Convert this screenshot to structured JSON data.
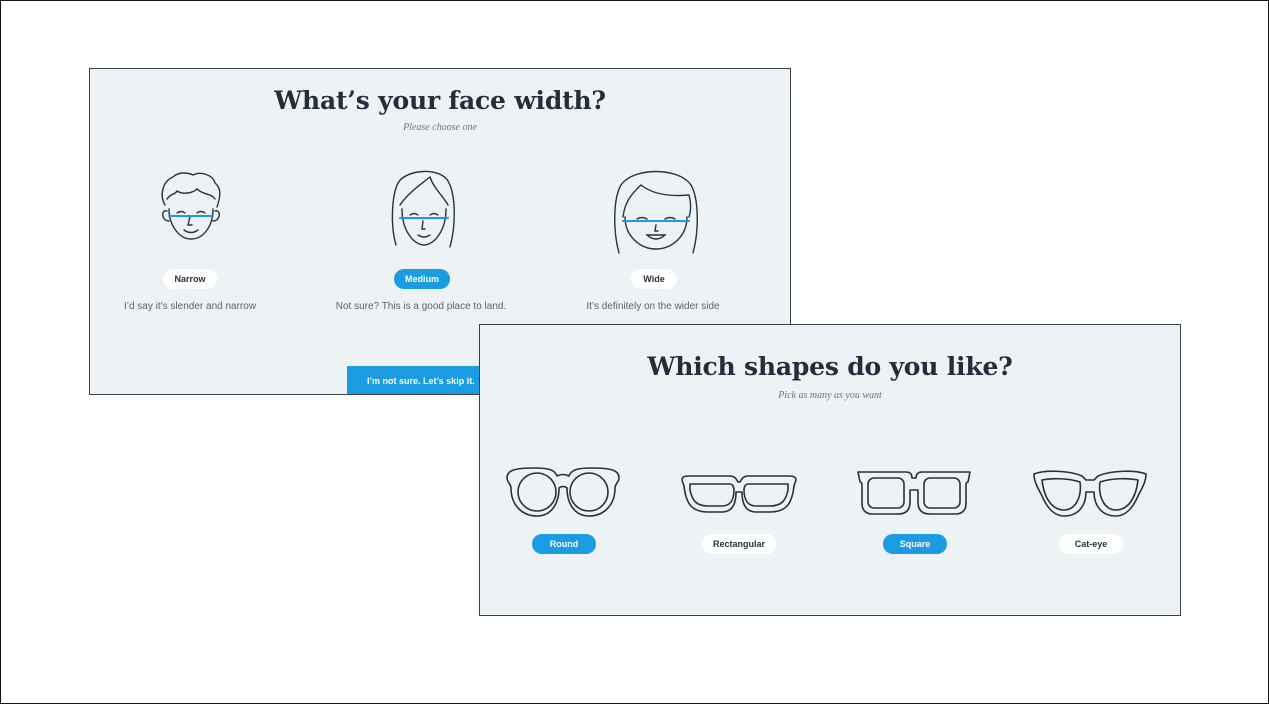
{
  "face_width": {
    "title": "What’s your face width?",
    "subtitle": "Please choose one",
    "options": [
      {
        "label": "Narrow",
        "description": "I’d say it’s slender and narrow",
        "selected": false,
        "icon": "narrow-face-icon"
      },
      {
        "label": "Medium",
        "description": "Not sure? This is a good place to land.",
        "selected": true,
        "icon": "medium-face-icon"
      },
      {
        "label": "Wide",
        "description": "It’s definitely on the wider side",
        "selected": false,
        "icon": "wide-face-icon"
      }
    ],
    "skip_label": "I’m not sure. Let’s skip it."
  },
  "shapes": {
    "title": "Which shapes do you like?",
    "subtitle": "Pick as many as you want",
    "options": [
      {
        "label": "Round",
        "selected": true,
        "icon": "round-glasses-icon"
      },
      {
        "label": "Rectangular",
        "selected": false,
        "icon": "rectangular-glasses-icon"
      },
      {
        "label": "Square",
        "selected": true,
        "icon": "square-glasses-icon"
      },
      {
        "label": "Cat-eye",
        "selected": false,
        "icon": "cat-eye-glasses-icon"
      }
    ]
  },
  "colors": {
    "accent": "#1a9be2",
    "card_bg": "#edf2f5",
    "ink": "#262d3a"
  }
}
